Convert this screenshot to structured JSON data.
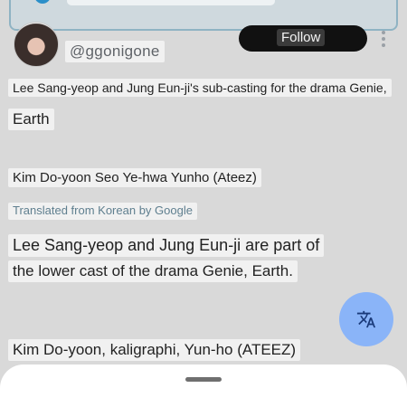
{
  "profile": {
    "handle": "@ggonigone",
    "follow_label": "Follow"
  },
  "post": {
    "original_line1": "Lee Sang-yeop and Jung Eun-ji's sub-casting for the drama Genie,",
    "original_line2": "Earth",
    "original_line3": "Kim Do-yoon Seo Ye-hwa Yunho (Ateez)",
    "translated_from": "Translated from Korean by Google",
    "translation_line1": "Lee Sang-yeop and Jung Eun-ji are part of",
    "translation_line2": "the lower cast of the drama Genie, Earth.",
    "translation_line3": "Kim Do-yoon, kaligraphi, Yun-ho (ATEEZ)"
  },
  "icons": {
    "translate": "translate-icon",
    "more": "more-vert-icon"
  },
  "colors": {
    "fab": "#8ab4f8",
    "follow_button": "#111111",
    "translated_link": "#5f7f8f"
  }
}
